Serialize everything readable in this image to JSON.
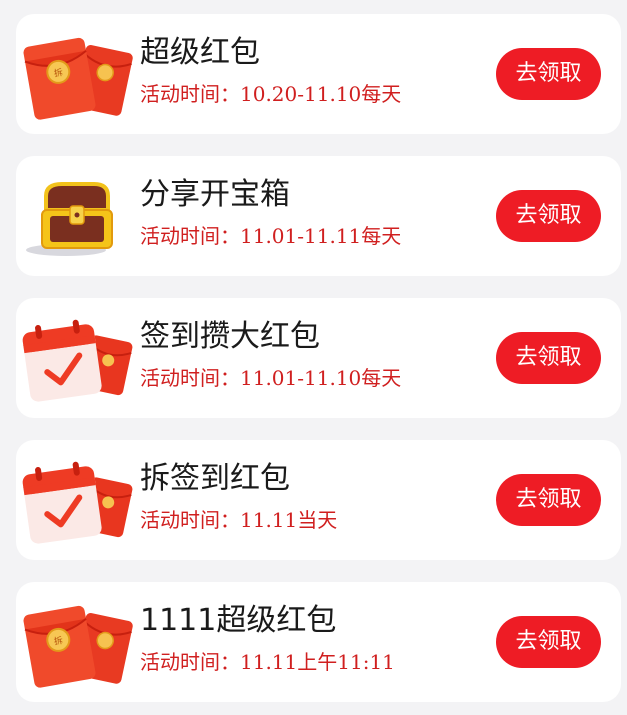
{
  "activities": [
    {
      "title": "超级红包",
      "time_label": "活动时间：",
      "time_value": "10.20-11.10每天",
      "button_label": "去领取",
      "icon": "red-envelope-icon"
    },
    {
      "title": "分享开宝箱",
      "time_label": "活动时间：",
      "time_value": "11.01-11.11每天",
      "button_label": "去领取",
      "icon": "treasure-chest-icon"
    },
    {
      "title": "签到攒大红包",
      "time_label": "活动时间：",
      "time_value": "11.01-11.10每天",
      "button_label": "去领取",
      "icon": "calendar-checkin-icon"
    },
    {
      "title": "拆签到红包",
      "time_label": "活动时间：",
      "time_value": "11.11当天",
      "button_label": "去领取",
      "icon": "calendar-checkin-icon"
    },
    {
      "title": "1111超级红包",
      "time_label": "活动时间：",
      "time_value": "11.11上午11:11",
      "button_label": "去领取",
      "icon": "red-envelope-icon"
    }
  ],
  "colors": {
    "background": "#f3f3f5",
    "card": "#ffffff",
    "button": "#ee1c25",
    "time_text": "#d01f1f",
    "title_text": "#1a1a1a"
  }
}
